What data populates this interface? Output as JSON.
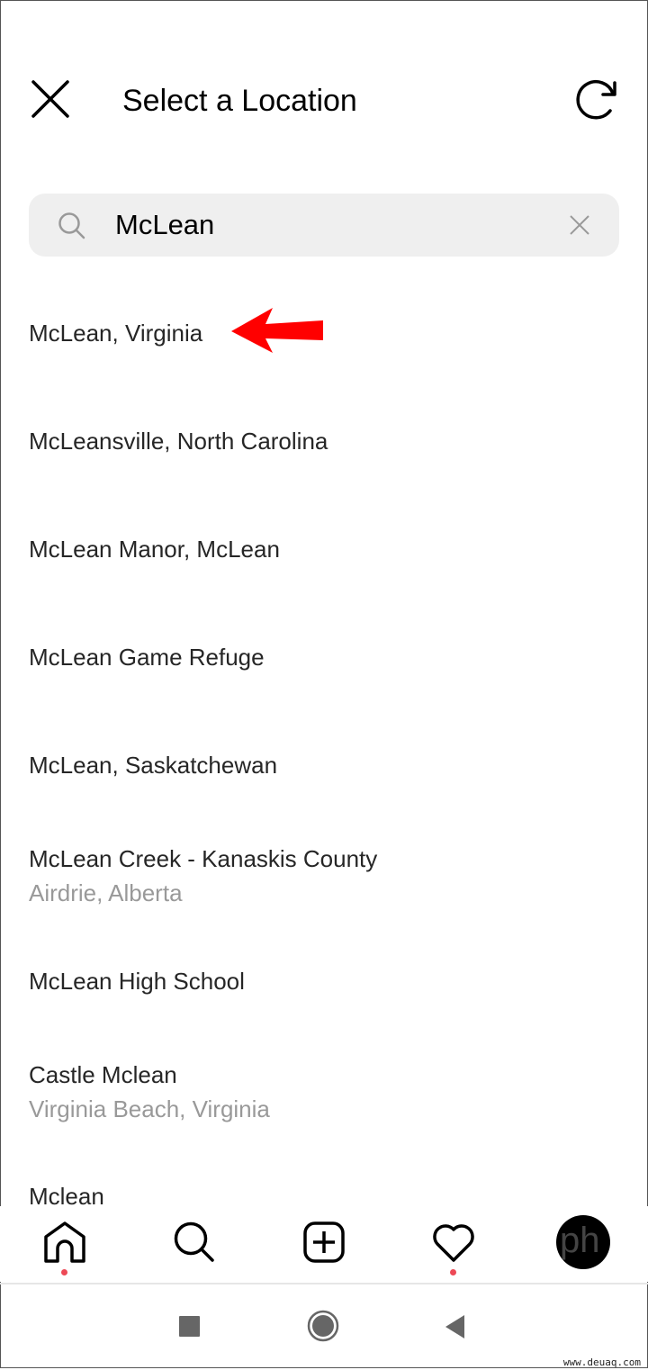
{
  "header": {
    "title": "Select a Location",
    "close_icon": "close-icon",
    "refresh_icon": "refresh-icon"
  },
  "search": {
    "value": "McLean",
    "search_icon": "search-icon",
    "clear_icon": "clear-icon"
  },
  "results": [
    {
      "title": "McLean, Virginia",
      "subtitle": ""
    },
    {
      "title": "McLeansville, North Carolina",
      "subtitle": ""
    },
    {
      "title": "McLean Manor, McLean",
      "subtitle": ""
    },
    {
      "title": "McLean Game Refuge",
      "subtitle": ""
    },
    {
      "title": "McLean, Saskatchewan",
      "subtitle": ""
    },
    {
      "title": "McLean Creek - Kanaskis County",
      "subtitle": "Airdrie, Alberta"
    },
    {
      "title": "McLean High School",
      "subtitle": ""
    },
    {
      "title": "Castle Mclean",
      "subtitle": "Virginia Beach, Virginia"
    },
    {
      "title": "Mclean",
      "subtitle": ""
    }
  ],
  "annotation": {
    "arrow_color": "#ff0000"
  },
  "nav": {
    "items": [
      "home-icon",
      "search-icon",
      "add-post-icon",
      "heart-icon",
      "profile-avatar"
    ],
    "notification_color": "#ed4956",
    "avatar_text": "ph"
  },
  "system_nav": [
    "recents-button",
    "home-button",
    "back-button"
  ],
  "watermark": "www.deuaq.com"
}
